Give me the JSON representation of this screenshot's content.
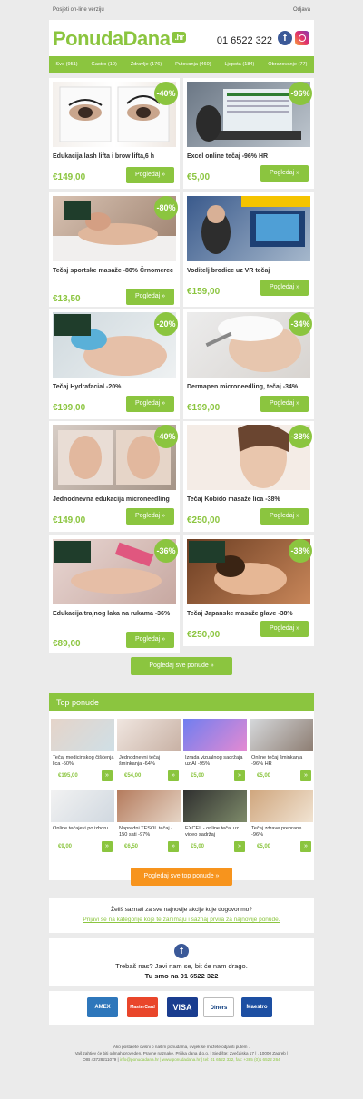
{
  "toplinks": {
    "online": "Posjeti on-line verziju",
    "logout": "Odjava"
  },
  "header": {
    "logo": "PonudaDana",
    "logo_badge": ".hr",
    "phone": "01 6522 322",
    "facebook": "f"
  },
  "nav": [
    "Sve (951)",
    "Gastro (10)",
    "Zdravlje (176)",
    "Putovanja (460)",
    "Ljepota (184)",
    "Obrazovanje (77)"
  ],
  "button_label": "Pogledaj »",
  "deals": [
    {
      "title": "Edukacija lash lifta i brow lifta,6 h",
      "price": "€149,00",
      "discount": "-40%"
    },
    {
      "title": "Excel online tečaj -96% HR",
      "price": "€5,00",
      "discount": "-96%"
    },
    {
      "title": "Tečaj sportske masaže -80% Črnomerec",
      "price": "€13,50",
      "discount": "-80%"
    },
    {
      "title": "Voditelj brodice uz VR tečaj",
      "price": "€159,00",
      "discount": ""
    },
    {
      "title": "Tečaj Hydrafacial -20%",
      "price": "€199,00",
      "discount": "-20%"
    },
    {
      "title": "Dermapen microneedling, tečaj -34%",
      "price": "€199,00",
      "discount": "-34%"
    },
    {
      "title": "Jednodnevna edukacija microneedling",
      "price": "€149,00",
      "discount": "-40%"
    },
    {
      "title": "Tečaj Kobido masaže lica -38%",
      "price": "€250,00",
      "discount": "-38%"
    },
    {
      "title": "Edukacija trajnog laka na rukama -36%",
      "price": "€89,00",
      "discount": "-36%"
    },
    {
      "title": "Tečaj Japanske masaže glave -38%",
      "price": "€250,00",
      "discount": "-38%"
    }
  ],
  "all_deals_button": "Pogledaj sve ponude »",
  "top": {
    "heading": "Top ponude",
    "items": [
      {
        "title": "Tečaj medicinskog čišćenja lica -50%",
        "price": "€195,00"
      },
      {
        "title": "Jednodnevni tečaj šminkanja -64%",
        "price": "€54,00"
      },
      {
        "title": "Izrada vizualnog sadržaja uz AI -95%",
        "price": "€5,00"
      },
      {
        "title": "Online tečaj šminkanja -96% HR",
        "price": "€5,00"
      },
      {
        "title": "Online tečajevi po izboru",
        "price": "€9,00"
      },
      {
        "title": "Napredni TESOL tečaj - 150 sati -97%",
        "price": "€6,50"
      },
      {
        "title": "EXCEL - online tečaj uz video sadržaj",
        "price": "€5,00"
      },
      {
        "title": "Tečaj zdrave prehrane -96%",
        "price": "€5,00"
      }
    ],
    "arrow": "»",
    "button": "Pogledaj sve top ponude »"
  },
  "signup": {
    "question": "Želiš saznati za sve najnovije akcije koje dogovorimo?",
    "link": "Prijavi se na kategorije koje te zanimaju i saznaj prvi/a za najnovije ponude."
  },
  "contact": {
    "line1": "Trebaš nas? Javi nam se, bit će nam drago.",
    "line2": "Tu smo na 01 6522 322"
  },
  "payment_cards": [
    "AMEX",
    "MasterCard",
    "VISA",
    "Diners",
    "Maestro"
  ],
  "footer": {
    "line1": "Ako postajete ovisni o našim ponudama, uvijek se možete odjaviti putem .",
    "line2": "Vaš zahtjev će biti odmah proveden. Pravne naznake. Prilika dana d.o.o. | Sjedište: Zvečajska 17 | , 10000 Zagreb |",
    "line3_a": "OIB 43728211079 | ",
    "line3_b": "info@ponudadana.hr | www.ponudadana.hr | tel: 01 6522 322, fax: +385 (0)1 6522 264"
  },
  "colors": {
    "accent": "#8bc53f",
    "orange": "#f7941d",
    "facebook": "#3b5998"
  }
}
